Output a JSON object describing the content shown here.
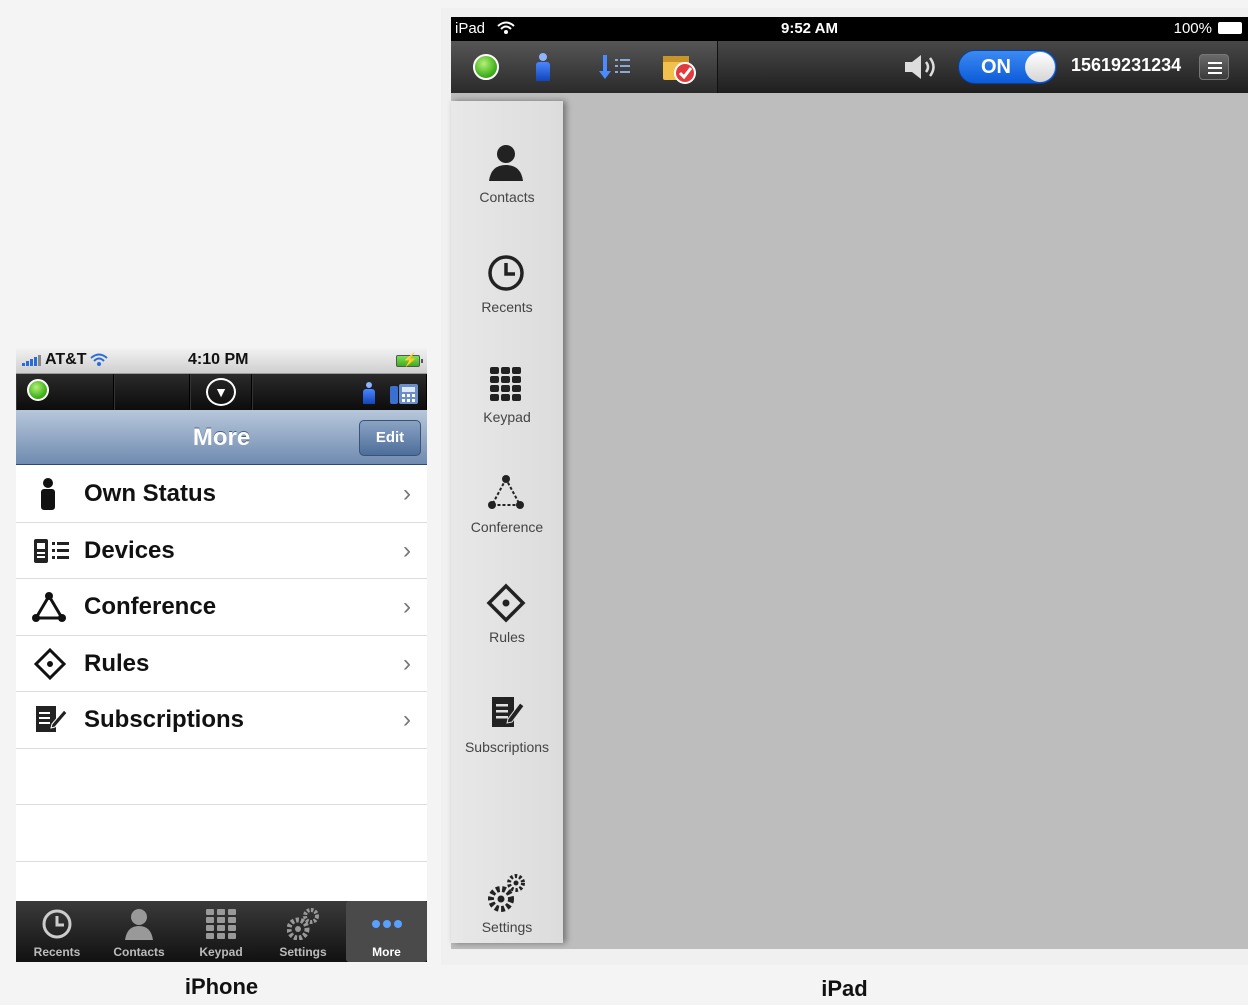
{
  "iphone": {
    "status": {
      "carrier": "AT&T",
      "time": "4:10 PM"
    },
    "nav": {
      "title": "More",
      "edit_label": "Edit"
    },
    "list": [
      {
        "label": "Own Status",
        "icon": "person-icon"
      },
      {
        "label": "Devices",
        "icon": "devices-icon"
      },
      {
        "label": "Conference",
        "icon": "conference-icon"
      },
      {
        "label": "Rules",
        "icon": "rules-icon"
      },
      {
        "label": "Subscriptions",
        "icon": "subscriptions-icon"
      }
    ],
    "tabs": [
      {
        "label": "Recents",
        "icon": "clock-icon"
      },
      {
        "label": "Contacts",
        "icon": "person-icon"
      },
      {
        "label": "Keypad",
        "icon": "keypad-icon"
      },
      {
        "label": "Settings",
        "icon": "gears-icon"
      },
      {
        "label": "More",
        "icon": "more-dots-icon",
        "active": true
      }
    ],
    "caption": "iPhone"
  },
  "ipad": {
    "status": {
      "device": "iPad",
      "time": "9:52 AM",
      "battery": "100%"
    },
    "toolbar": {
      "toggle_label": "ON",
      "phone_number": "15619231234"
    },
    "sidebar": [
      {
        "label": "Contacts",
        "icon": "person-icon"
      },
      {
        "label": "Recents",
        "icon": "clock-icon"
      },
      {
        "label": "Keypad",
        "icon": "keypad-icon"
      },
      {
        "label": "Conference",
        "icon": "conference-icon"
      },
      {
        "label": "Rules",
        "icon": "rules-icon"
      },
      {
        "label": "Subscriptions",
        "icon": "subscriptions-icon"
      },
      {
        "label": "Settings",
        "icon": "gears-icon"
      }
    ],
    "caption": "iPad"
  },
  "colors": {
    "nav_blue": "#6f8bb0",
    "status_green": "#45b51e",
    "toggle_blue": "#0c5bd8",
    "content_gray": "#bdbdbd"
  }
}
